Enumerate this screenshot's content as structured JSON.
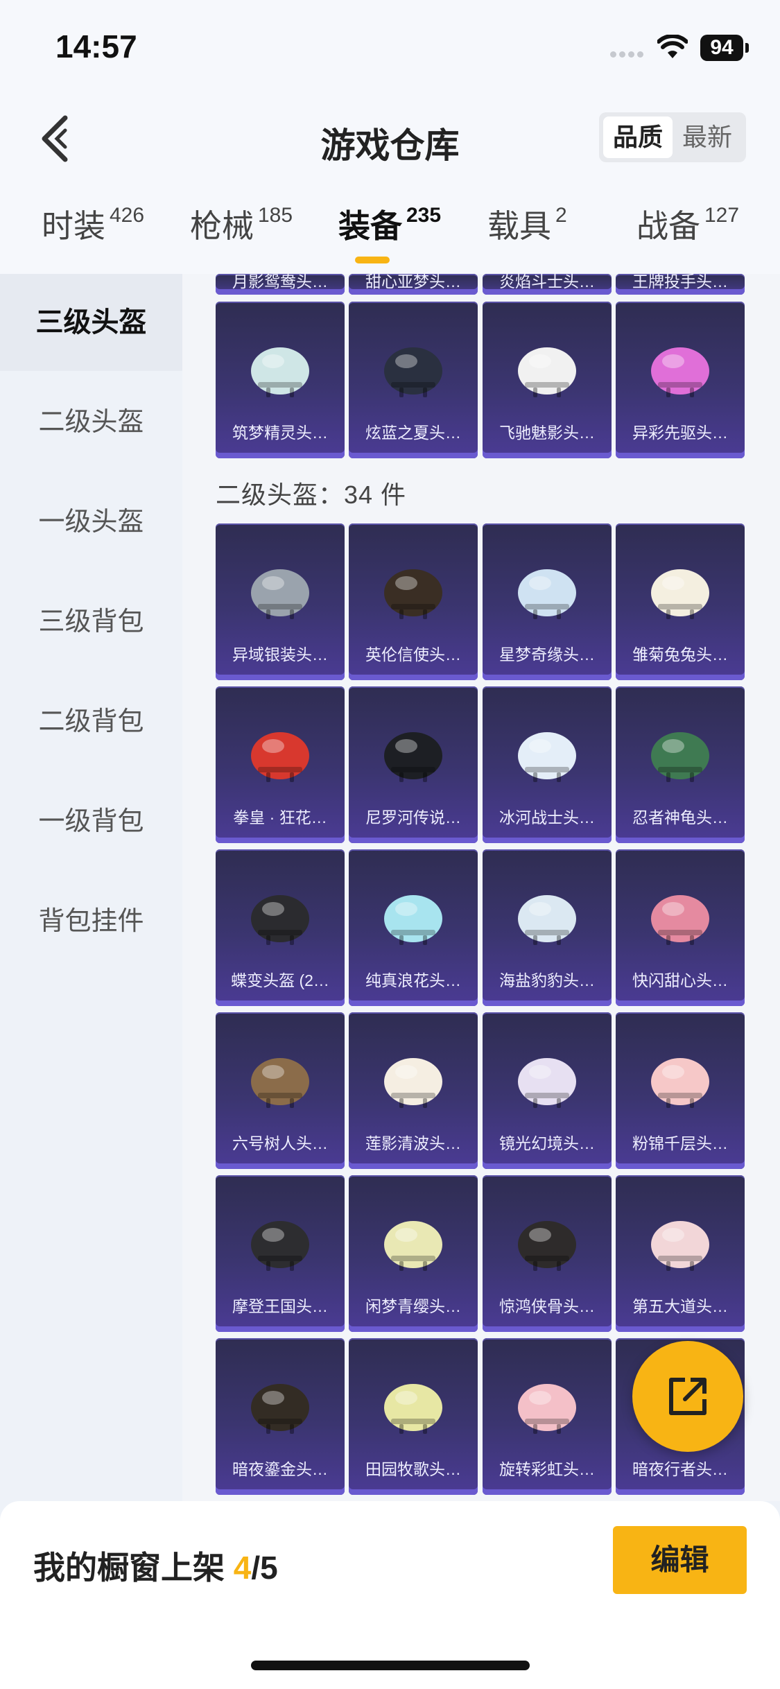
{
  "status_bar": {
    "time": "14:57",
    "battery": "94"
  },
  "header": {
    "title": "游戏仓库",
    "sort_active": "品质",
    "sort_other": "最新"
  },
  "tabs": [
    {
      "label": "时装",
      "count": "426"
    },
    {
      "label": "枪械",
      "count": "185"
    },
    {
      "label": "装备",
      "count": "235"
    },
    {
      "label": "载具",
      "count": "2"
    },
    {
      "label": "战备",
      "count": "127"
    }
  ],
  "sidebar": [
    "三级头盔",
    "二级头盔",
    "一级头盔",
    "三级背包",
    "二级背包",
    "一级背包",
    "背包挂件"
  ],
  "top_partial_row": [
    "月影鸳鸯头…",
    "甜心亚梦头…",
    "炎焰斗士头…",
    "王牌投手头…"
  ],
  "level3_row": [
    "筑梦精灵头…",
    "炫蓝之夏头…",
    "飞驰魅影头…",
    "异彩先驱头…"
  ],
  "level2_title": "二级头盔：34 件",
  "level2_items": [
    "异域银装头…",
    "英伦信使头…",
    "星梦奇缘头…",
    "雏菊兔兔头…",
    "拳皇 · 狂花…",
    "尼罗河传说…",
    "冰河战士头…",
    "忍者神龟头…",
    "蝶变头盔 (2…",
    "纯真浪花头…",
    "海盐豹豹头…",
    "快闪甜心头…",
    "六号树人头…",
    "莲影清波头…",
    "镜光幻境头…",
    "粉锦千层头…",
    "摩登王国头…",
    "闲梦青缨头…",
    "惊鸿侠骨头…",
    "第五大道头…",
    "暗夜鎏金头…",
    "田园牧歌头…",
    "旋转彩虹头…",
    "暗夜行者头…"
  ],
  "footer": {
    "shelf_label": "我的橱窗上架 ",
    "shelf_current": "4",
    "shelf_total": "/5",
    "edit_label": "编辑"
  },
  "colors": {
    "accent": "#f8b414",
    "card_bg": "#3b3570"
  }
}
